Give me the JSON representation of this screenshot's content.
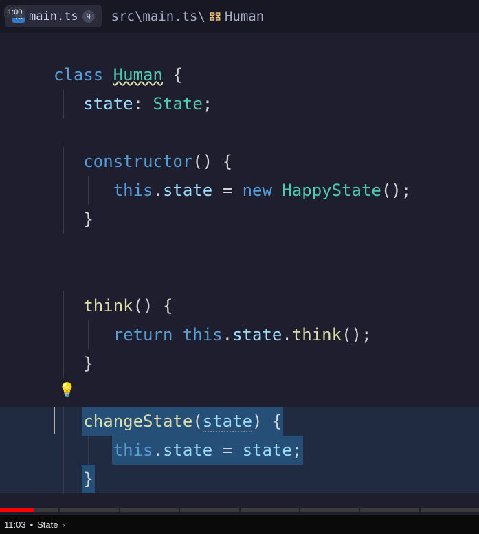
{
  "timestamp_overlay": "1:00",
  "tab": {
    "icon": "TS",
    "filename": "main.ts",
    "badge": "9"
  },
  "breadcrumb": {
    "path": "src\\main.ts\\",
    "symbol_icon": "class",
    "symbol": "Human"
  },
  "code": {
    "lines": [
      {
        "tokens": [
          {
            "t": "class ",
            "c": "kw"
          },
          {
            "t": "Human",
            "c": "cls-underline"
          },
          {
            "t": " {",
            "c": "plain"
          }
        ]
      },
      {
        "indent": 1,
        "tokens": [
          {
            "t": "state",
            "c": "prop"
          },
          {
            "t": ": ",
            "c": "plain"
          },
          {
            "t": "State",
            "c": "cls"
          },
          {
            "t": ";",
            "c": "plain"
          }
        ]
      },
      {
        "blank": true
      },
      {
        "indent": 1,
        "tokens": [
          {
            "t": "constructor",
            "c": "kw"
          },
          {
            "t": "() {",
            "c": "plain"
          }
        ]
      },
      {
        "indent": 2,
        "tokens": [
          {
            "t": "this",
            "c": "kw"
          },
          {
            "t": ".",
            "c": "plain"
          },
          {
            "t": "state",
            "c": "prop"
          },
          {
            "t": " = ",
            "c": "plain"
          },
          {
            "t": "new ",
            "c": "kw"
          },
          {
            "t": "HappyState",
            "c": "cls"
          },
          {
            "t": "();",
            "c": "plain"
          }
        ]
      },
      {
        "indent": 1,
        "tokens": [
          {
            "t": "}",
            "c": "plain"
          }
        ]
      },
      {
        "blank": true
      },
      {
        "blank": true
      },
      {
        "indent": 1,
        "tokens": [
          {
            "t": "think",
            "c": "fn"
          },
          {
            "t": "() {",
            "c": "plain"
          }
        ]
      },
      {
        "indent": 2,
        "tokens": [
          {
            "t": "return ",
            "c": "kw"
          },
          {
            "t": "this",
            "c": "kw"
          },
          {
            "t": ".",
            "c": "plain"
          },
          {
            "t": "state",
            "c": "prop"
          },
          {
            "t": ".",
            "c": "plain"
          },
          {
            "t": "think",
            "c": "fn"
          },
          {
            "t": "();",
            "c": "plain"
          }
        ]
      },
      {
        "indent": 1,
        "tokens": [
          {
            "t": "}",
            "c": "plain"
          }
        ]
      },
      {
        "lightbulb": true,
        "blank": true
      },
      {
        "indent": 1,
        "selected": true,
        "cursor": true,
        "tokens": [
          {
            "t": "changeState",
            "c": "fn"
          },
          {
            "t": "(",
            "c": "plain"
          },
          {
            "t": "state",
            "c": "prop param"
          },
          {
            "t": ") {",
            "c": "plain"
          }
        ]
      },
      {
        "indent": 2,
        "selected": true,
        "tokens": [
          {
            "t": "this",
            "c": "kw"
          },
          {
            "t": ".",
            "c": "plain"
          },
          {
            "t": "state",
            "c": "prop"
          },
          {
            "t": " = ",
            "c": "plain"
          },
          {
            "t": "state",
            "c": "prop"
          },
          {
            "t": ";",
            "c": "plain"
          }
        ]
      },
      {
        "indent": 1,
        "selected": true,
        "tokens": [
          {
            "t": "}",
            "c": "plain"
          }
        ]
      }
    ]
  },
  "video": {
    "progress_percent": 7,
    "segments": 8
  },
  "status": {
    "time": "11:03",
    "separator": "•",
    "title": "State",
    "chevron": "›"
  }
}
